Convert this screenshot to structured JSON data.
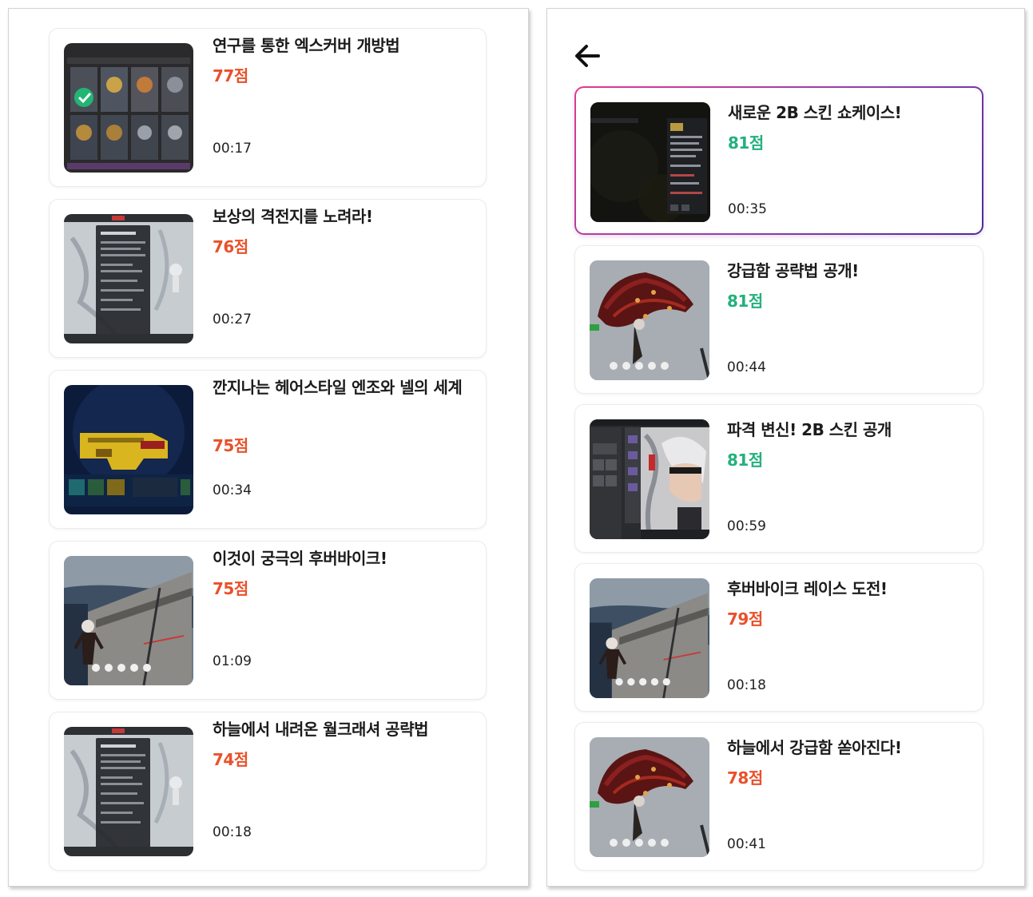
{
  "left_panel": {
    "items": [
      {
        "title": "연구를 통한 엑스커버 개방법",
        "score": "77점",
        "duration": "00:17",
        "thumbnail": "inventory-grid-screenshot"
      },
      {
        "title": "보상의 격전지를 노려라!",
        "score": "76점",
        "duration": "00:27",
        "thumbnail": "snow-map-menu-screenshot"
      },
      {
        "title": "깐지나는 헤어스타일 엔조와 넬의 세계",
        "score": "75점",
        "duration": "00:34",
        "thumbnail": "yellow-gun-screenshot"
      },
      {
        "title": "이것이 궁극의 후버바이크!",
        "score": "75점",
        "duration": "01:09",
        "thumbnail": "hoverbike-bridge-screenshot"
      },
      {
        "title": "하늘에서 내려온 월크래셔 공략법",
        "score": "74점",
        "duration": "00:18",
        "thumbnail": "snow-map-menu-screenshot"
      }
    ]
  },
  "right_panel": {
    "back_icon": "arrow-left-icon",
    "items": [
      {
        "title": "새로운 2B 스킨 쇼케이스!",
        "score": "81점",
        "duration": "00:35",
        "thumbnail": "dark-skin-menu-screenshot",
        "selected": true
      },
      {
        "title": "강급함 공략법 공개!",
        "score": "81점",
        "duration": "00:44",
        "thumbnail": "red-creature-screenshot"
      },
      {
        "title": "파격 변신! 2B 스킨 공개",
        "score": "81점",
        "duration": "00:59",
        "thumbnail": "white-hair-character-screenshot"
      },
      {
        "title": "후버바이크 레이스 도전!",
        "score": "79점",
        "duration": "00:18",
        "thumbnail": "hoverbike-bridge-screenshot"
      },
      {
        "title": "하늘에서 강급함 쏟아진다!",
        "score": "78점",
        "duration": "00:41",
        "thumbnail": "red-creature-screenshot"
      }
    ]
  },
  "colors": {
    "score_warm": "#e8512b",
    "score_cool": "#23b07d",
    "highlight_gradient_start": "#e23a8e",
    "highlight_gradient_end": "#4b2a9c"
  }
}
